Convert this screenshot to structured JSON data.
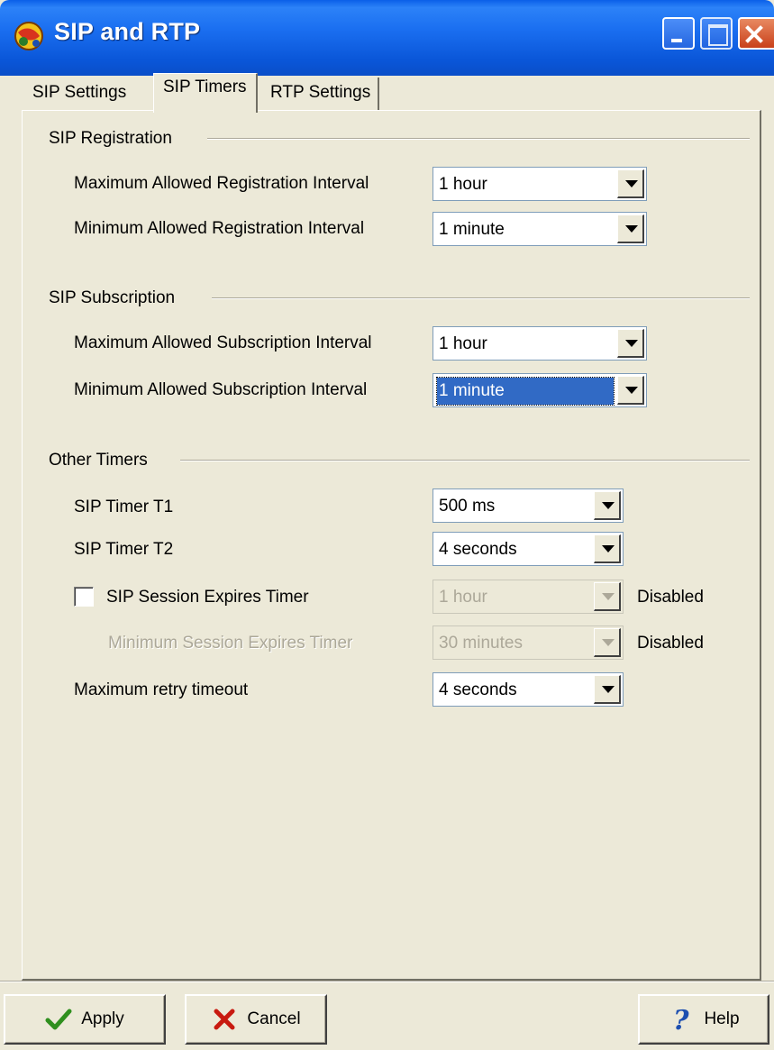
{
  "window": {
    "title": "SIP and RTP"
  },
  "tabs": [
    {
      "label": "SIP Settings",
      "active": false
    },
    {
      "label": "SIP Timers",
      "active": true
    },
    {
      "label": "RTP Settings",
      "active": false
    }
  ],
  "sip_registration": {
    "heading": "SIP Registration",
    "max_label": "Maximum Allowed Registration Interval",
    "max_value": "1 hour",
    "min_label": "Minimum Allowed Registration Interval",
    "min_value": "1 minute"
  },
  "sip_subscription": {
    "heading": "SIP Subscription",
    "max_label": "Maximum Allowed Subscription Interval",
    "max_value": "1 hour",
    "min_label": "Minimum Allowed Subscription Interval",
    "min_value": "1 minute"
  },
  "other_timers": {
    "heading": "Other Timers",
    "t1_label": "SIP Timer T1",
    "t1_value": "500 ms",
    "t2_label": "SIP Timer T2",
    "t2_value": "4 seconds",
    "session_expires_label": "SIP Session Expires Timer",
    "session_expires_checked": false,
    "session_expires_value": "1 hour",
    "session_expires_status": "Disabled",
    "min_session_label": "Minimum Session Expires Timer",
    "min_session_value": "30 minutes",
    "min_session_status": "Disabled",
    "retry_label": "Maximum retry timeout",
    "retry_value": "4 seconds"
  },
  "buttons": {
    "apply": "Apply",
    "cancel": "Cancel",
    "help": "Help"
  },
  "colors": {
    "titlebar": "#0a5fe8",
    "face": "#ece9d8",
    "selection": "#316ac5"
  }
}
